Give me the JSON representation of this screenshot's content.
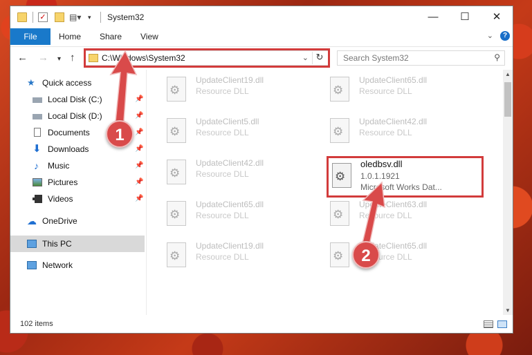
{
  "window": {
    "title": "System32",
    "controls": {
      "minimize": "—",
      "maximize": "☐",
      "close": "✕"
    }
  },
  "ribbon": {
    "file_tab": "File",
    "tabs": [
      "Home",
      "Share",
      "View"
    ],
    "expand_icon": "chevron-down-icon",
    "help_label": "?"
  },
  "address_bar": {
    "path": "C:\\Windows\\System32",
    "search_placeholder": "Search System32"
  },
  "nav_pane": {
    "quick_access": "Quick access",
    "quick_items": [
      {
        "label": "Local Disk (C:)",
        "icon": "drive-icon",
        "pinned": true
      },
      {
        "label": "Local Disk (D:)",
        "icon": "drive-icon",
        "pinned": true
      },
      {
        "label": "Documents",
        "icon": "documents-icon",
        "pinned": true
      },
      {
        "label": "Downloads",
        "icon": "downloads-icon",
        "pinned": true
      },
      {
        "label": "Music",
        "icon": "music-icon",
        "pinned": true
      },
      {
        "label": "Pictures",
        "icon": "pictures-icon",
        "pinned": true
      },
      {
        "label": "Videos",
        "icon": "videos-icon",
        "pinned": true
      }
    ],
    "onedrive": "OneDrive",
    "this_pc": "This PC",
    "network": "Network"
  },
  "files": {
    "faded": [
      {
        "name": "UpdateClient19.dll",
        "type": "Resource DLL"
      },
      {
        "name": "UpdateClient65.dll",
        "type": "Resource DLL"
      },
      {
        "name": "UpdateClient5.dll",
        "type": "Resource DLL"
      },
      {
        "name": "UpdateClient42.dll",
        "type": "Resource DLL"
      },
      {
        "name": "UpdateClient42.dll",
        "type": "Resource DLL"
      },
      {
        "name": "UpdateClient65.dll",
        "type": "Resource DLL"
      },
      {
        "name": "UpdateClient63.dll",
        "type": "Resource DLL"
      },
      {
        "name": "UpdateClient19.dll",
        "type": "Resource DLL"
      },
      {
        "name": "UpdateClient65.dll",
        "type": "Resource DLL"
      }
    ],
    "target": {
      "name": "oledbsv.dll",
      "version": "1.0.1.1921",
      "description": "Microsoft Works Dat..."
    }
  },
  "status": {
    "item_count": "102 items"
  },
  "annotations": {
    "step1": "1",
    "step2": "2",
    "color": "#d94a4a"
  }
}
